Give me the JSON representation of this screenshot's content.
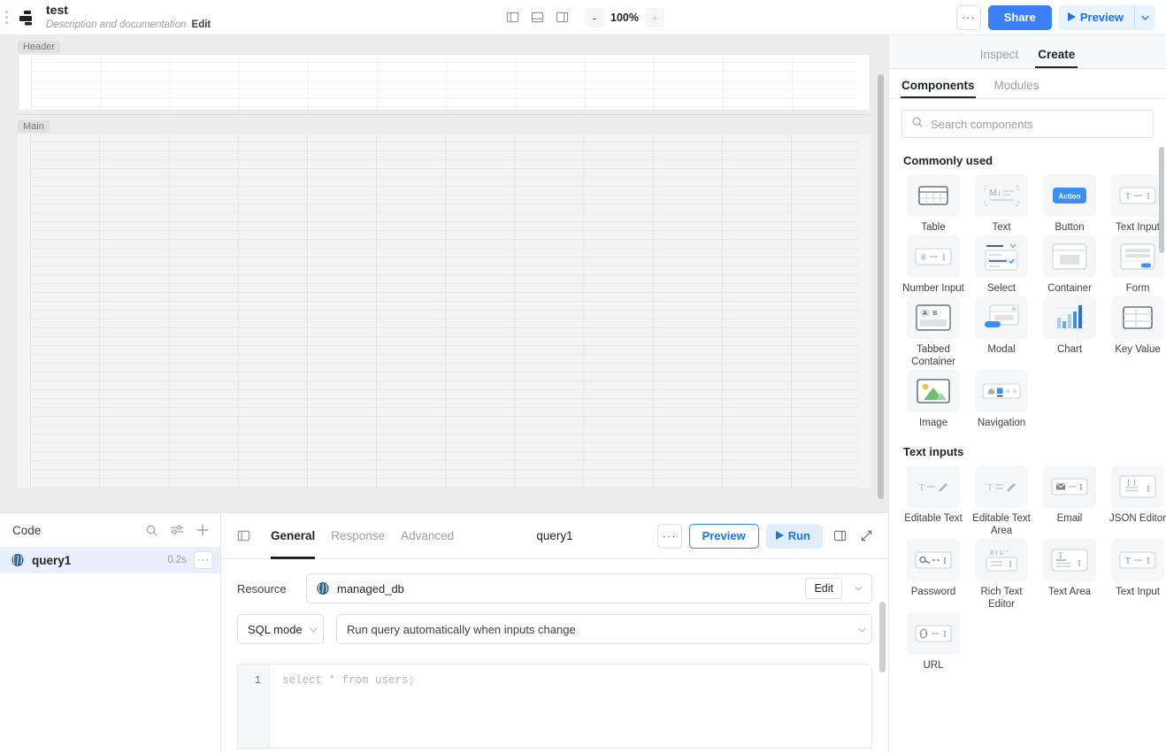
{
  "topbar": {
    "logo_icon": "retool-logo-icon",
    "drag_handle_icon": "drag-handle-icon",
    "title": "test",
    "description": "Description and documentation",
    "edit_label": "Edit",
    "panel_left_icon": "panel-left-icon",
    "panel_bottom_icon": "panel-bottom-icon",
    "panel_right_icon": "panel-right-icon",
    "zoom_out_label": "-",
    "zoom_value": "100%",
    "zoom_in_label": "+",
    "more_label": "···",
    "share_label": "Share",
    "preview_label": "Preview",
    "preview_caret": "˅"
  },
  "canvas": {
    "header_tag": "Header",
    "main_tag": "Main"
  },
  "code_panel": {
    "title": "Code",
    "search_icon": "search-icon",
    "filter_icon": "filter-icon",
    "add_icon": "plus-icon",
    "queries": [
      {
        "name": "query1",
        "duration": "0.2s",
        "icon": "postgres-icon",
        "kebab": "···"
      }
    ]
  },
  "query_editor": {
    "panel_icon": "panel-left-icon",
    "tabs": [
      {
        "label": "General",
        "active": true
      },
      {
        "label": "Response",
        "active": false
      },
      {
        "label": "Advanced",
        "active": false
      }
    ],
    "name": "query1",
    "more_label": "···",
    "preview_label": "Preview",
    "run_label": "Run",
    "dock_icon": "dock-right-icon",
    "expand_icon": "expand-icon",
    "resource_label": "Resource",
    "resource_value": "managed_db",
    "resource_icon": "postgres-icon",
    "resource_edit_label": "Edit",
    "mode_value": "SQL mode",
    "trigger_value": "Run query automatically when inputs change",
    "sql_line_number": "1",
    "sql_text": "select * from users;"
  },
  "right_panel": {
    "tabs": [
      {
        "label": "Inspect",
        "active": false
      },
      {
        "label": "Create",
        "active": true
      }
    ],
    "subtabs": [
      {
        "label": "Components",
        "active": true
      },
      {
        "label": "Modules",
        "active": false
      }
    ],
    "search_placeholder": "Search components",
    "search_value": "",
    "search_icon": "search-icon",
    "groups": [
      {
        "title": "Commonly used",
        "items": [
          {
            "label": "Table",
            "icon": "table-icon"
          },
          {
            "label": "Text",
            "icon": "markdown-text-icon"
          },
          {
            "label": "Button",
            "icon": "button-icon",
            "icon_text": "Action"
          },
          {
            "label": "Text Input",
            "icon": "text-input-icon"
          },
          {
            "label": "Number Input",
            "icon": "number-input-icon"
          },
          {
            "label": "Select",
            "icon": "select-icon"
          },
          {
            "label": "Container",
            "icon": "container-icon"
          },
          {
            "label": "Form",
            "icon": "form-icon"
          },
          {
            "label": "Tabbed Container",
            "icon": "tabbed-container-icon"
          },
          {
            "label": "Modal",
            "icon": "modal-icon"
          },
          {
            "label": "Chart",
            "icon": "chart-icon"
          },
          {
            "label": "Key Value",
            "icon": "key-value-icon"
          },
          {
            "label": "Image",
            "icon": "image-icon"
          },
          {
            "label": "Navigation",
            "icon": "navigation-icon"
          }
        ]
      },
      {
        "title": "Text inputs",
        "items": [
          {
            "label": "Editable Text",
            "icon": "editable-text-icon"
          },
          {
            "label": "Editable Text Area",
            "icon": "editable-text-area-icon"
          },
          {
            "label": "Email",
            "icon": "email-icon"
          },
          {
            "label": "JSON Editor",
            "icon": "json-editor-icon"
          },
          {
            "label": "Password",
            "icon": "password-icon"
          },
          {
            "label": "Rich Text Editor",
            "icon": "rich-text-editor-icon"
          },
          {
            "label": "Text Area",
            "icon": "text-area-icon"
          },
          {
            "label": "Text Input",
            "icon": "text-input-icon"
          },
          {
            "label": "URL",
            "icon": "url-icon"
          }
        ]
      }
    ]
  },
  "colors": {
    "accent": "#3c7ff5",
    "accent_soft": "#e8f1fe",
    "selected_row": "#e8f0fe",
    "canvas_bg": "#ececec",
    "tile_bg": "#f5f6f7"
  }
}
